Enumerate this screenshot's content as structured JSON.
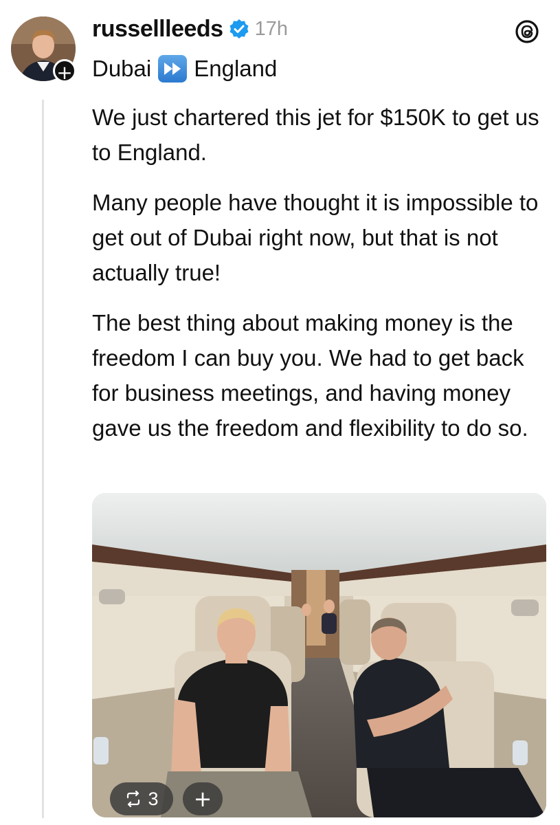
{
  "post": {
    "username": "russellleeds",
    "time": "17h",
    "location_from": "Dubai",
    "location_icon": "fast-forward-emoji",
    "location_to": "England",
    "paragraphs": [
      "We just chartered this jet for $150K to get us to England.",
      "Many people have thought it is impossible to get out of Dubai right now, but that is not actually true!",
      "The best thing about making money is the freedom I can buy you. We had to get back for business meetings, and having money gave us the freedom and flexibility to do so."
    ],
    "repost_count": "3",
    "add_label": "+",
    "follow_label": "+"
  },
  "icons": {
    "verified": "verified-badge-icon",
    "app": "threads-logo-icon",
    "repost": "repost-icon"
  },
  "colors": {
    "verified_blue": "#1d9bf0",
    "text": "#111111",
    "muted": "#9a9a9a"
  }
}
